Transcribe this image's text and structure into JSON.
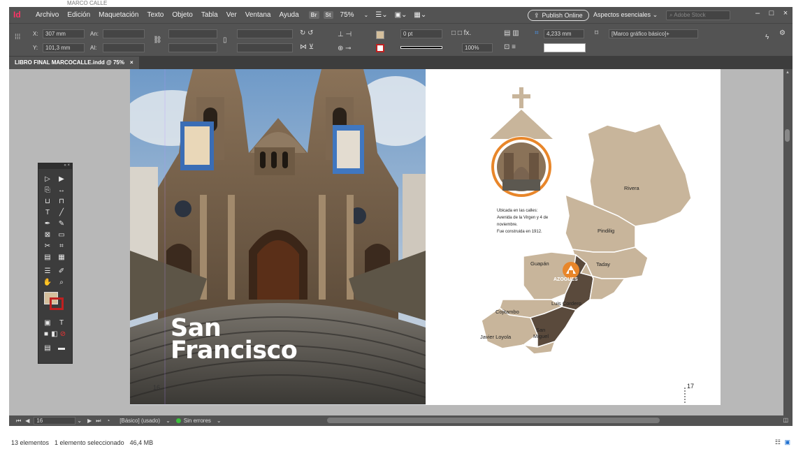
{
  "explorer": {
    "title": "MARCO CALLE",
    "status_items": "13 elementos",
    "status_selected": "1 elemento seleccionado",
    "status_size": "46,4 MB"
  },
  "menubar": {
    "logo": "Id",
    "items": [
      "Archivo",
      "Edición",
      "Maquetación",
      "Texto",
      "Objeto",
      "Tabla",
      "Ver",
      "Ventana",
      "Ayuda"
    ],
    "br_label": "Br",
    "st_label": "St",
    "zoom": "75%",
    "publish_label": "Publish Online",
    "workspace": "Aspectos esenciales",
    "stock_placeholder": "Adobe Stock"
  },
  "controlbar": {
    "x_label": "X:",
    "x_value": "307 mm",
    "y_label": "Y:",
    "y_value": "101,3 mm",
    "w_label": "An:",
    "h_label": "Al:",
    "stroke_weight": "0 pt",
    "opacity": "100%",
    "size_field": "4,233 mm",
    "frame_style": "[Marco gráfico básico]+"
  },
  "document_tab": {
    "label": "LIBRO FINAL MARCOCALLE.indd @ 75%",
    "close": "×"
  },
  "pages": {
    "left_title_line1": "San",
    "left_title_line2": "Francisco",
    "left_page_number": "16",
    "right_page_number": "17",
    "church_caption": [
      "Ubicada en las calles:",
      "Avenida de la Virgen y 4 de",
      "noviembre.",
      "Fue construida en 1912."
    ],
    "map_labels": {
      "rivera": "Rivera",
      "pindilig": "Pindilig",
      "guapan": "Guapán",
      "taday": "Taday",
      "azogues": "AZOGUES",
      "luis_cordero": "Luis Cordero",
      "cojitambo": "Cojitambo",
      "javier_loyola": "Javier Loyola",
      "san_miguel_1": "San",
      "san_miguel_2": "Miguel"
    }
  },
  "statusbar": {
    "page": "16",
    "style": "[Básico] (usado)",
    "errors": "Sin errores"
  },
  "colors": {
    "app_bg": "#535353",
    "canvas_bg": "#b8b8b8",
    "map_fill": "#c8b59b",
    "map_dark": "#5a4a3c",
    "accent_orange": "#e8862a",
    "swatch_fill": "#d4bf9c",
    "no_errors": "#3cbf3c"
  }
}
